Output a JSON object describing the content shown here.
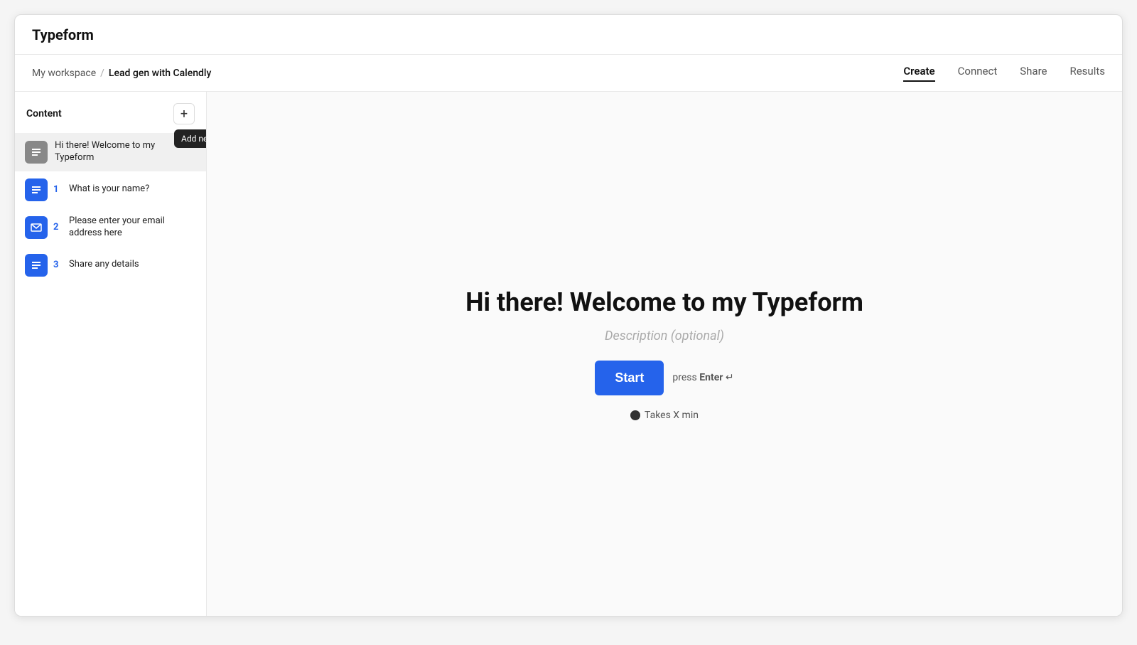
{
  "app": {
    "title": "Typeform"
  },
  "breadcrumb": {
    "workspace": "My workspace",
    "separator": "/",
    "form_name": "Lead gen with Calendly"
  },
  "nav_tabs": [
    {
      "label": "Create",
      "active": true
    },
    {
      "label": "Connect",
      "active": false
    },
    {
      "label": "Share",
      "active": false
    },
    {
      "label": "Results",
      "active": false
    }
  ],
  "sidebar": {
    "header_label": "Content",
    "add_button_label": "+",
    "tooltip_label": "Add new question (⌘ + /)",
    "items": [
      {
        "type": "welcome",
        "icon_type": "gray",
        "text": "Hi there! Welcome to my Typeform"
      },
      {
        "type": "question",
        "icon_type": "blue",
        "num": "1",
        "text": "What is your name?"
      },
      {
        "type": "question",
        "icon_type": "blue",
        "num": "2",
        "text": "Please enter your email address here"
      },
      {
        "type": "question",
        "icon_type": "blue",
        "num": "3",
        "text": "Share any details"
      }
    ]
  },
  "form_preview": {
    "title": "Hi there! Welcome to my Typeform",
    "description": "Description (optional)",
    "start_button": "Start",
    "press_enter_label": "press Enter ↵",
    "takes_time_label": "Takes X min"
  },
  "colors": {
    "accent_blue": "#2563EB",
    "dark": "#111111",
    "gray": "#888888"
  }
}
